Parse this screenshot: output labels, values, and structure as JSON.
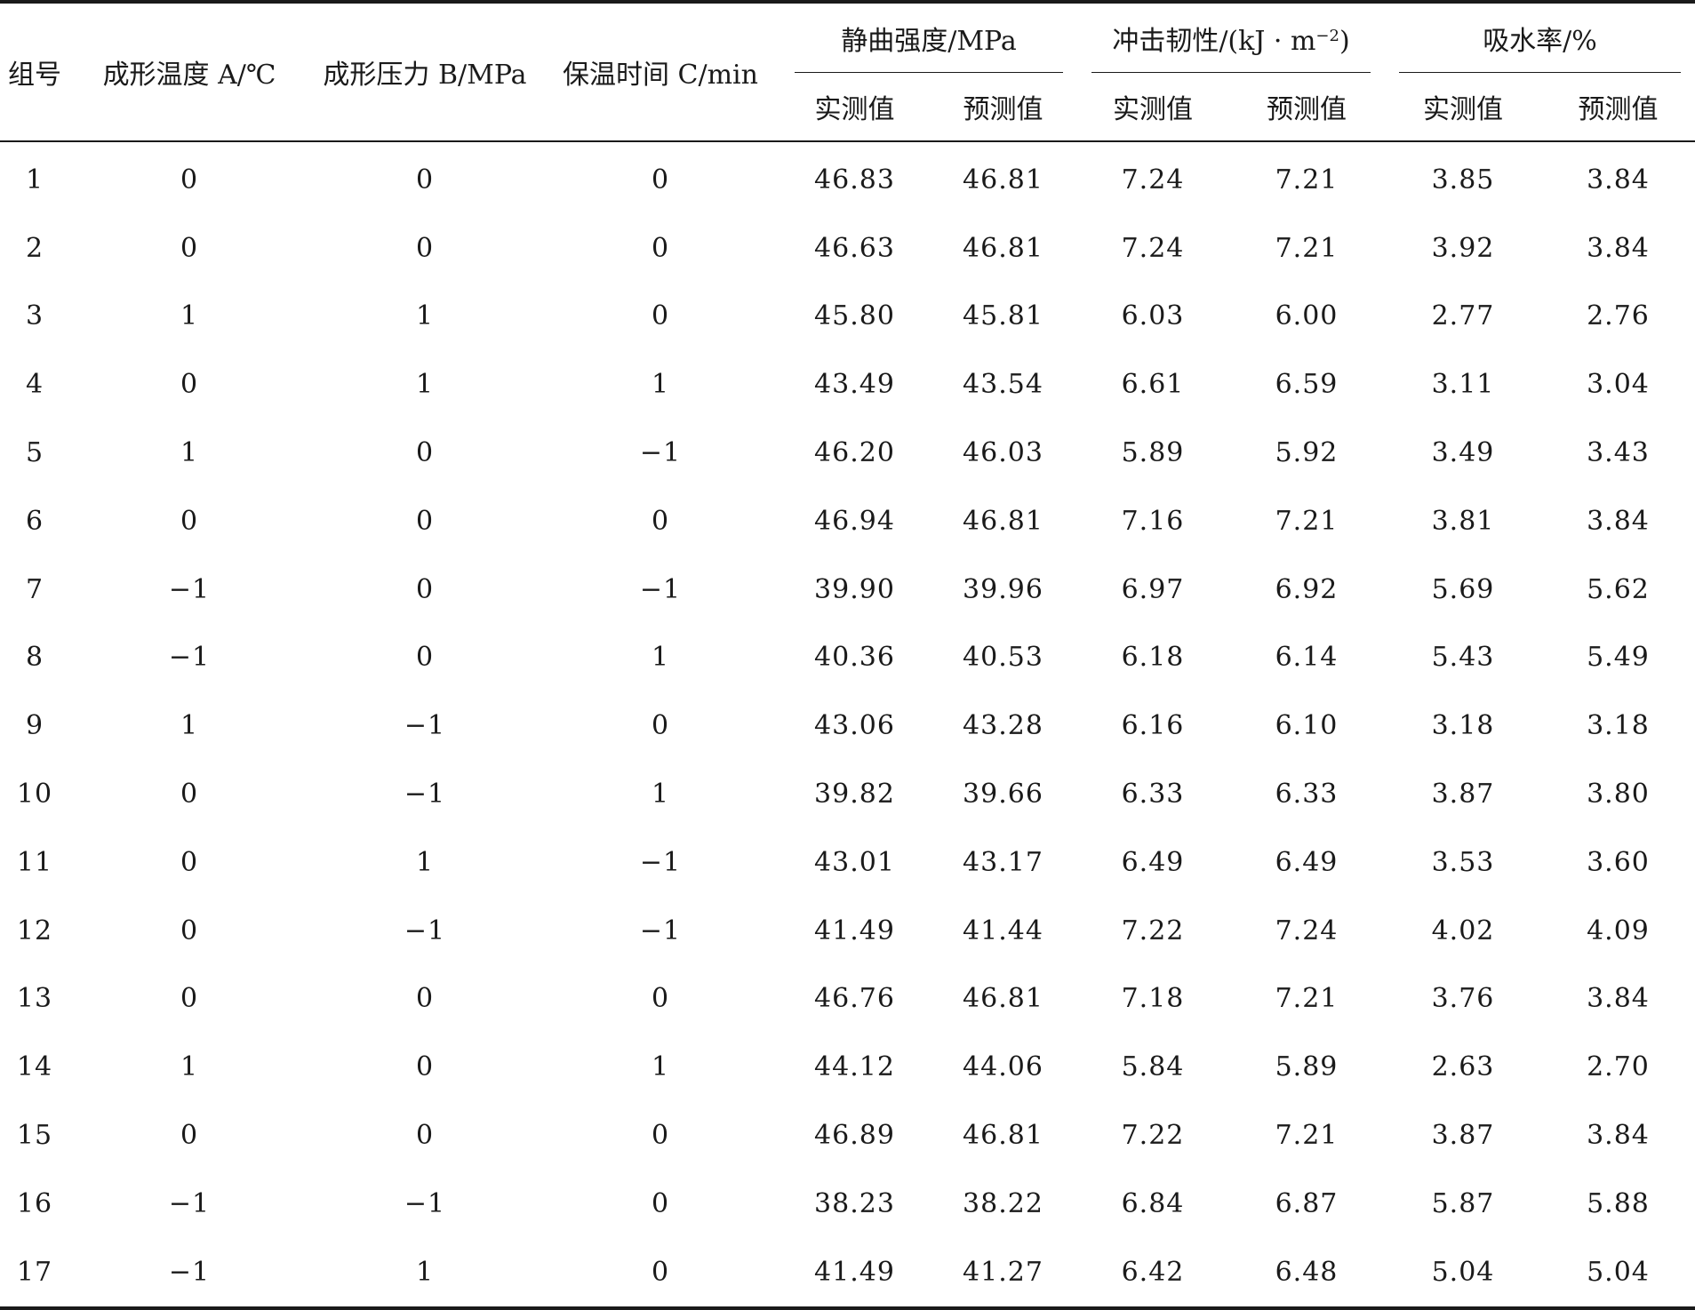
{
  "table": {
    "headers": {
      "group": "组号",
      "temp": "成形温度 A/℃",
      "pressure": "成形压力 B/MPa",
      "time": "保温时间 C/min",
      "flex": "静曲强度/MPa",
      "impact_prefix": "冲击韧性/(kJ · m",
      "impact_sup": "−2",
      "impact_suffix": ")",
      "water": "吸水率/%",
      "measured": "实测值",
      "predicted": "预测值"
    },
    "rows": [
      [
        "1",
        "0",
        "0",
        "0",
        "46.83",
        "46.81",
        "7.24",
        "7.21",
        "3.85",
        "3.84"
      ],
      [
        "2",
        "0",
        "0",
        "0",
        "46.63",
        "46.81",
        "7.24",
        "7.21",
        "3.92",
        "3.84"
      ],
      [
        "3",
        "1",
        "1",
        "0",
        "45.80",
        "45.81",
        "6.03",
        "6.00",
        "2.77",
        "2.76"
      ],
      [
        "4",
        "0",
        "1",
        "1",
        "43.49",
        "43.54",
        "6.61",
        "6.59",
        "3.11",
        "3.04"
      ],
      [
        "5",
        "1",
        "0",
        "−1",
        "46.20",
        "46.03",
        "5.89",
        "5.92",
        "3.49",
        "3.43"
      ],
      [
        "6",
        "0",
        "0",
        "0",
        "46.94",
        "46.81",
        "7.16",
        "7.21",
        "3.81",
        "3.84"
      ],
      [
        "7",
        "−1",
        "0",
        "−1",
        "39.90",
        "39.96",
        "6.97",
        "6.92",
        "5.69",
        "5.62"
      ],
      [
        "8",
        "−1",
        "0",
        "1",
        "40.36",
        "40.53",
        "6.18",
        "6.14",
        "5.43",
        "5.49"
      ],
      [
        "9",
        "1",
        "−1",
        "0",
        "43.06",
        "43.28",
        "6.16",
        "6.10",
        "3.18",
        "3.18"
      ],
      [
        "10",
        "0",
        "−1",
        "1",
        "39.82",
        "39.66",
        "6.33",
        "6.33",
        "3.87",
        "3.80"
      ],
      [
        "11",
        "0",
        "1",
        "−1",
        "43.01",
        "43.17",
        "6.49",
        "6.49",
        "3.53",
        "3.60"
      ],
      [
        "12",
        "0",
        "−1",
        "−1",
        "41.49",
        "41.44",
        "7.22",
        "7.24",
        "4.02",
        "4.09"
      ],
      [
        "13",
        "0",
        "0",
        "0",
        "46.76",
        "46.81",
        "7.18",
        "7.21",
        "3.76",
        "3.84"
      ],
      [
        "14",
        "1",
        "0",
        "1",
        "44.12",
        "44.06",
        "5.84",
        "5.89",
        "2.63",
        "2.70"
      ],
      [
        "15",
        "0",
        "0",
        "0",
        "46.89",
        "46.81",
        "7.22",
        "7.21",
        "3.87",
        "3.84"
      ],
      [
        "16",
        "−1",
        "−1",
        "0",
        "38.23",
        "38.22",
        "6.84",
        "6.87",
        "5.87",
        "5.88"
      ],
      [
        "17",
        "−1",
        "1",
        "0",
        "41.49",
        "41.27",
        "6.42",
        "6.48",
        "5.04",
        "5.04"
      ]
    ]
  }
}
